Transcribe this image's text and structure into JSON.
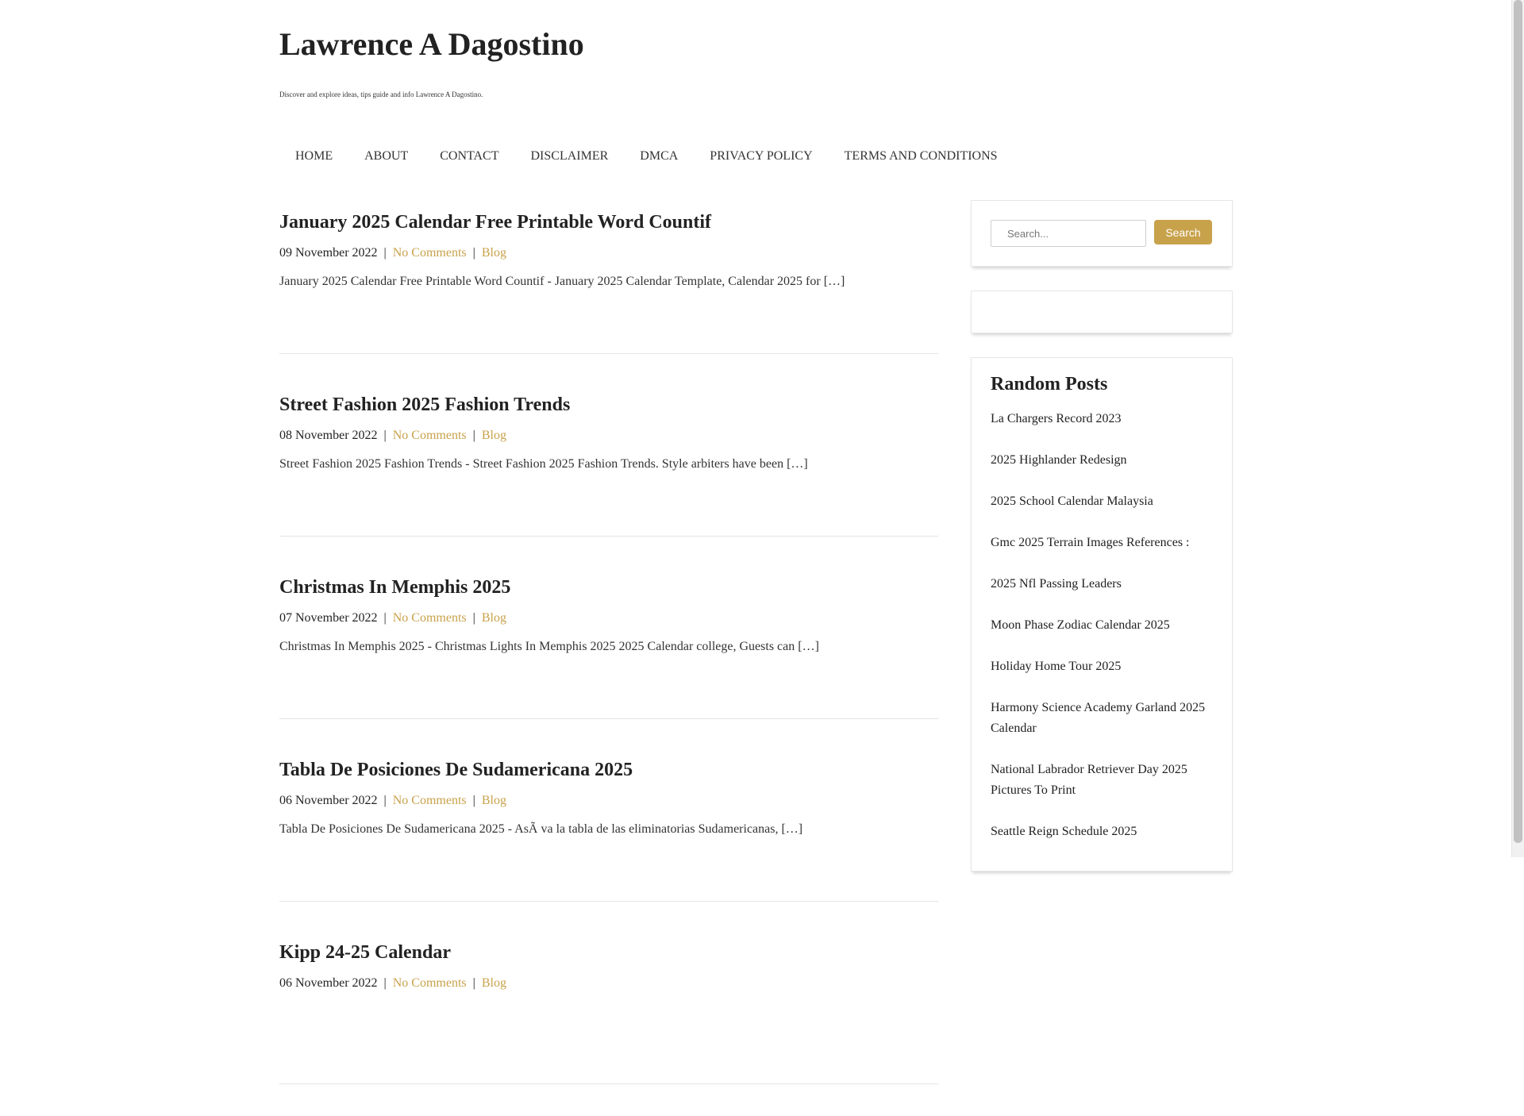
{
  "site": {
    "title": "Lawrence A Dagostino",
    "description": "Discover and explore ideas, tips guide and info Lawrence A Dagostino."
  },
  "nav": [
    "HOME",
    "ABOUT",
    "CONTACT",
    "DISCLAIMER",
    "DMCA",
    "PRIVACY POLICY",
    "TERMS AND CONDITIONS"
  ],
  "posts": [
    {
      "title": "January 2025 Calendar Free Printable Word Countif",
      "date": "09 November 2022",
      "comments": "No Comments",
      "category": "Blog",
      "excerpt": "January 2025 Calendar Free Printable Word Countif - January 2025 Calendar Template, Calendar 2025 for […]"
    },
    {
      "title": "Street Fashion 2025 Fashion Trends",
      "date": "08 November 2022",
      "comments": "No Comments",
      "category": "Blog",
      "excerpt": "Street Fashion 2025 Fashion Trends - Street Fashion 2025 Fashion Trends. Style arbiters have been […]"
    },
    {
      "title": "Christmas In Memphis 2025",
      "date": "07 November 2022",
      "comments": "No Comments",
      "category": "Blog",
      "excerpt": "Christmas In Memphis 2025 - Christmas Lights In Memphis 2025 2025 Calendar college, Guests can […]"
    },
    {
      "title": "Tabla De Posiciones De Sudamericana 2025",
      "date": "06 November 2022",
      "comments": "No Comments",
      "category": "Blog",
      "excerpt": "Tabla De Posiciones De Sudamericana 2025 - AsÃ va la tabla de las eliminatorias Sudamericanas, […]"
    },
    {
      "title": "Kipp 24-25 Calendar",
      "date": "06 November 2022",
      "comments": "No Comments",
      "category": "Blog",
      "excerpt": ""
    }
  ],
  "sidebar": {
    "search": {
      "placeholder": "Search...",
      "button_label": "Search"
    },
    "random_posts": {
      "title": "Random Posts",
      "items": [
        "La Chargers Record 2023",
        "2025 Highlander Redesign",
        "2025 School Calendar Malaysia",
        "Gmc 2025 Terrain Images References :",
        "2025 Nfl Passing Leaders",
        "Moon Phase Zodiac Calendar 2025",
        "Holiday Home Tour 2025",
        "Harmony Science Academy Garland 2025 Calendar",
        "National Labrador Retriever Day 2025 Pictures To Print",
        "Seattle Reign Schedule 2025"
      ]
    }
  },
  "colors": {
    "accent": "#c8a24b",
    "text": "#222222"
  }
}
